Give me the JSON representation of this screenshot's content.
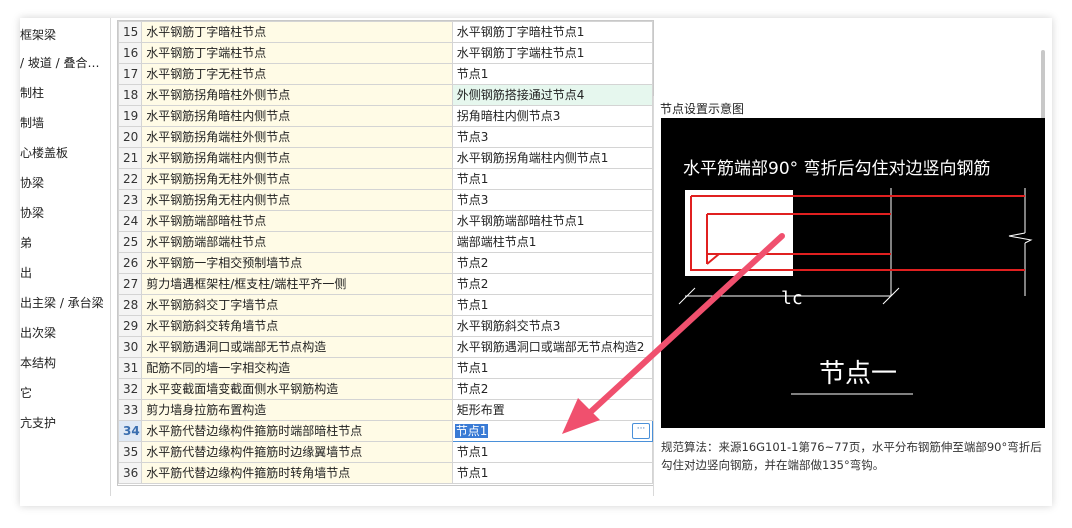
{
  "tree_items": [
    "框架梁",
    "/ 坡道 / 叠合…",
    "制柱",
    "制墙",
    "心楼盖板",
    "协梁",
    "协梁",
    "弟",
    "出",
    "出主梁 / 承台梁",
    "出次梁",
    "本结构",
    "它",
    "亢支护"
  ],
  "rows": [
    {
      "num": "15",
      "name": "水平钢筋丁字暗柱节点",
      "value": "水平钢筋丁字暗柱节点1"
    },
    {
      "num": "16",
      "name": "水平钢筋丁字端柱节点",
      "value": "水平钢筋丁字端柱节点1"
    },
    {
      "num": "17",
      "name": "水平钢筋丁字无柱节点",
      "value": "节点1"
    },
    {
      "num": "18",
      "name": "水平钢筋拐角暗柱外侧节点",
      "value": "外侧钢筋搭接通过节点4"
    },
    {
      "num": "19",
      "name": "水平钢筋拐角暗柱内侧节点",
      "value": "拐角暗柱内侧节点3"
    },
    {
      "num": "20",
      "name": "水平钢筋拐角端柱外侧节点",
      "value": "节点3"
    },
    {
      "num": "21",
      "name": "水平钢筋拐角端柱内侧节点",
      "value": "水平钢筋拐角端柱内侧节点1"
    },
    {
      "num": "22",
      "name": "水平钢筋拐角无柱外侧节点",
      "value": "节点1"
    },
    {
      "num": "23",
      "name": "水平钢筋拐角无柱内侧节点",
      "value": "节点3"
    },
    {
      "num": "24",
      "name": "水平钢筋端部暗柱节点",
      "value": "水平钢筋端部暗柱节点1"
    },
    {
      "num": "25",
      "name": "水平钢筋端部端柱节点",
      "value": "端部端柱节点1"
    },
    {
      "num": "26",
      "name": "水平钢筋一字相交预制墙节点",
      "value": "节点2"
    },
    {
      "num": "27",
      "name": "剪力墙遇框架柱/框支柱/端柱平齐一侧",
      "value": "节点2"
    },
    {
      "num": "28",
      "name": "水平钢筋斜交丁字墙节点",
      "value": "节点1"
    },
    {
      "num": "29",
      "name": "水平钢筋斜交转角墙节点",
      "value": "水平钢筋斜交节点3"
    },
    {
      "num": "30",
      "name": "水平钢筋遇洞口或端部无节点构造",
      "value": "水平钢筋遇洞口或端部无节点构造2"
    },
    {
      "num": "31",
      "name": "配筋不同的墙一字相交构造",
      "value": "节点1"
    },
    {
      "num": "32",
      "name": "水平变截面墙变截面侧水平钢筋构造",
      "value": "节点2"
    },
    {
      "num": "33",
      "name": "剪力墙身拉筋布置构造",
      "value": "矩形布置"
    },
    {
      "num": "34",
      "name": "水平筋代替边缘构件箍筋时端部暗柱节点",
      "value": "节点1"
    },
    {
      "num": "35",
      "name": "水平筋代替边缘构件箍筋时边缘翼墙节点",
      "value": "节点1"
    },
    {
      "num": "36",
      "name": "水平筋代替边缘构件箍筋时转角墙节点",
      "value": "节点1"
    }
  ],
  "highlight_value_row": "18",
  "active_row": "34",
  "edit_button_label": "···",
  "panel": {
    "title": "节点设置示意图",
    "diagram_caption": "水平筋端部90° 弯折后勾住对边竖向钢筋",
    "dimension_label": "lc",
    "node_label": "节点一",
    "description": "规范算法：来源16G101-1第76~77页，水平分布钢筋伸至端部90°弯折后勾住对边竖向钢筋，并在端部做135°弯钩。"
  },
  "colors": {
    "name_cell_bg": "#fffbe6",
    "highlight_row_bg": "#e6f7ee",
    "rebar_red": "#e02020",
    "arrow_pink": "#f0506e"
  }
}
